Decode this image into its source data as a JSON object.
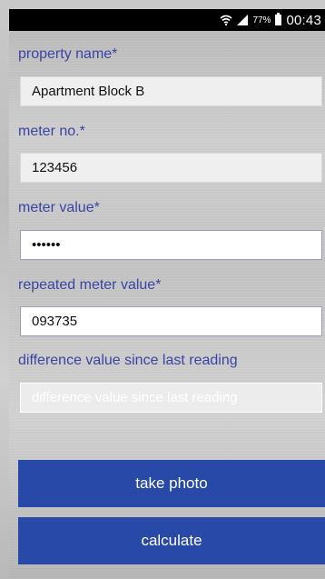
{
  "status_bar": {
    "wifi_icon": "wifi-icon",
    "signal_icon": "signal-icon",
    "battery_percent": "77%",
    "battery_icon": "battery-icon",
    "time": "00:43"
  },
  "form": {
    "property_name": {
      "label": "property name*",
      "value": "Apartment Block B"
    },
    "meter_no": {
      "label": "meter no.*",
      "value": "123456"
    },
    "meter_value": {
      "label": "meter value*",
      "value": "••••••"
    },
    "repeated_meter_value": {
      "label": "repeated meter value*",
      "value": "093735"
    },
    "difference_value": {
      "label": "difference value since last reading",
      "placeholder": "difference value since last reading"
    }
  },
  "buttons": {
    "take_photo": "take photo",
    "calculate": "calculate"
  }
}
